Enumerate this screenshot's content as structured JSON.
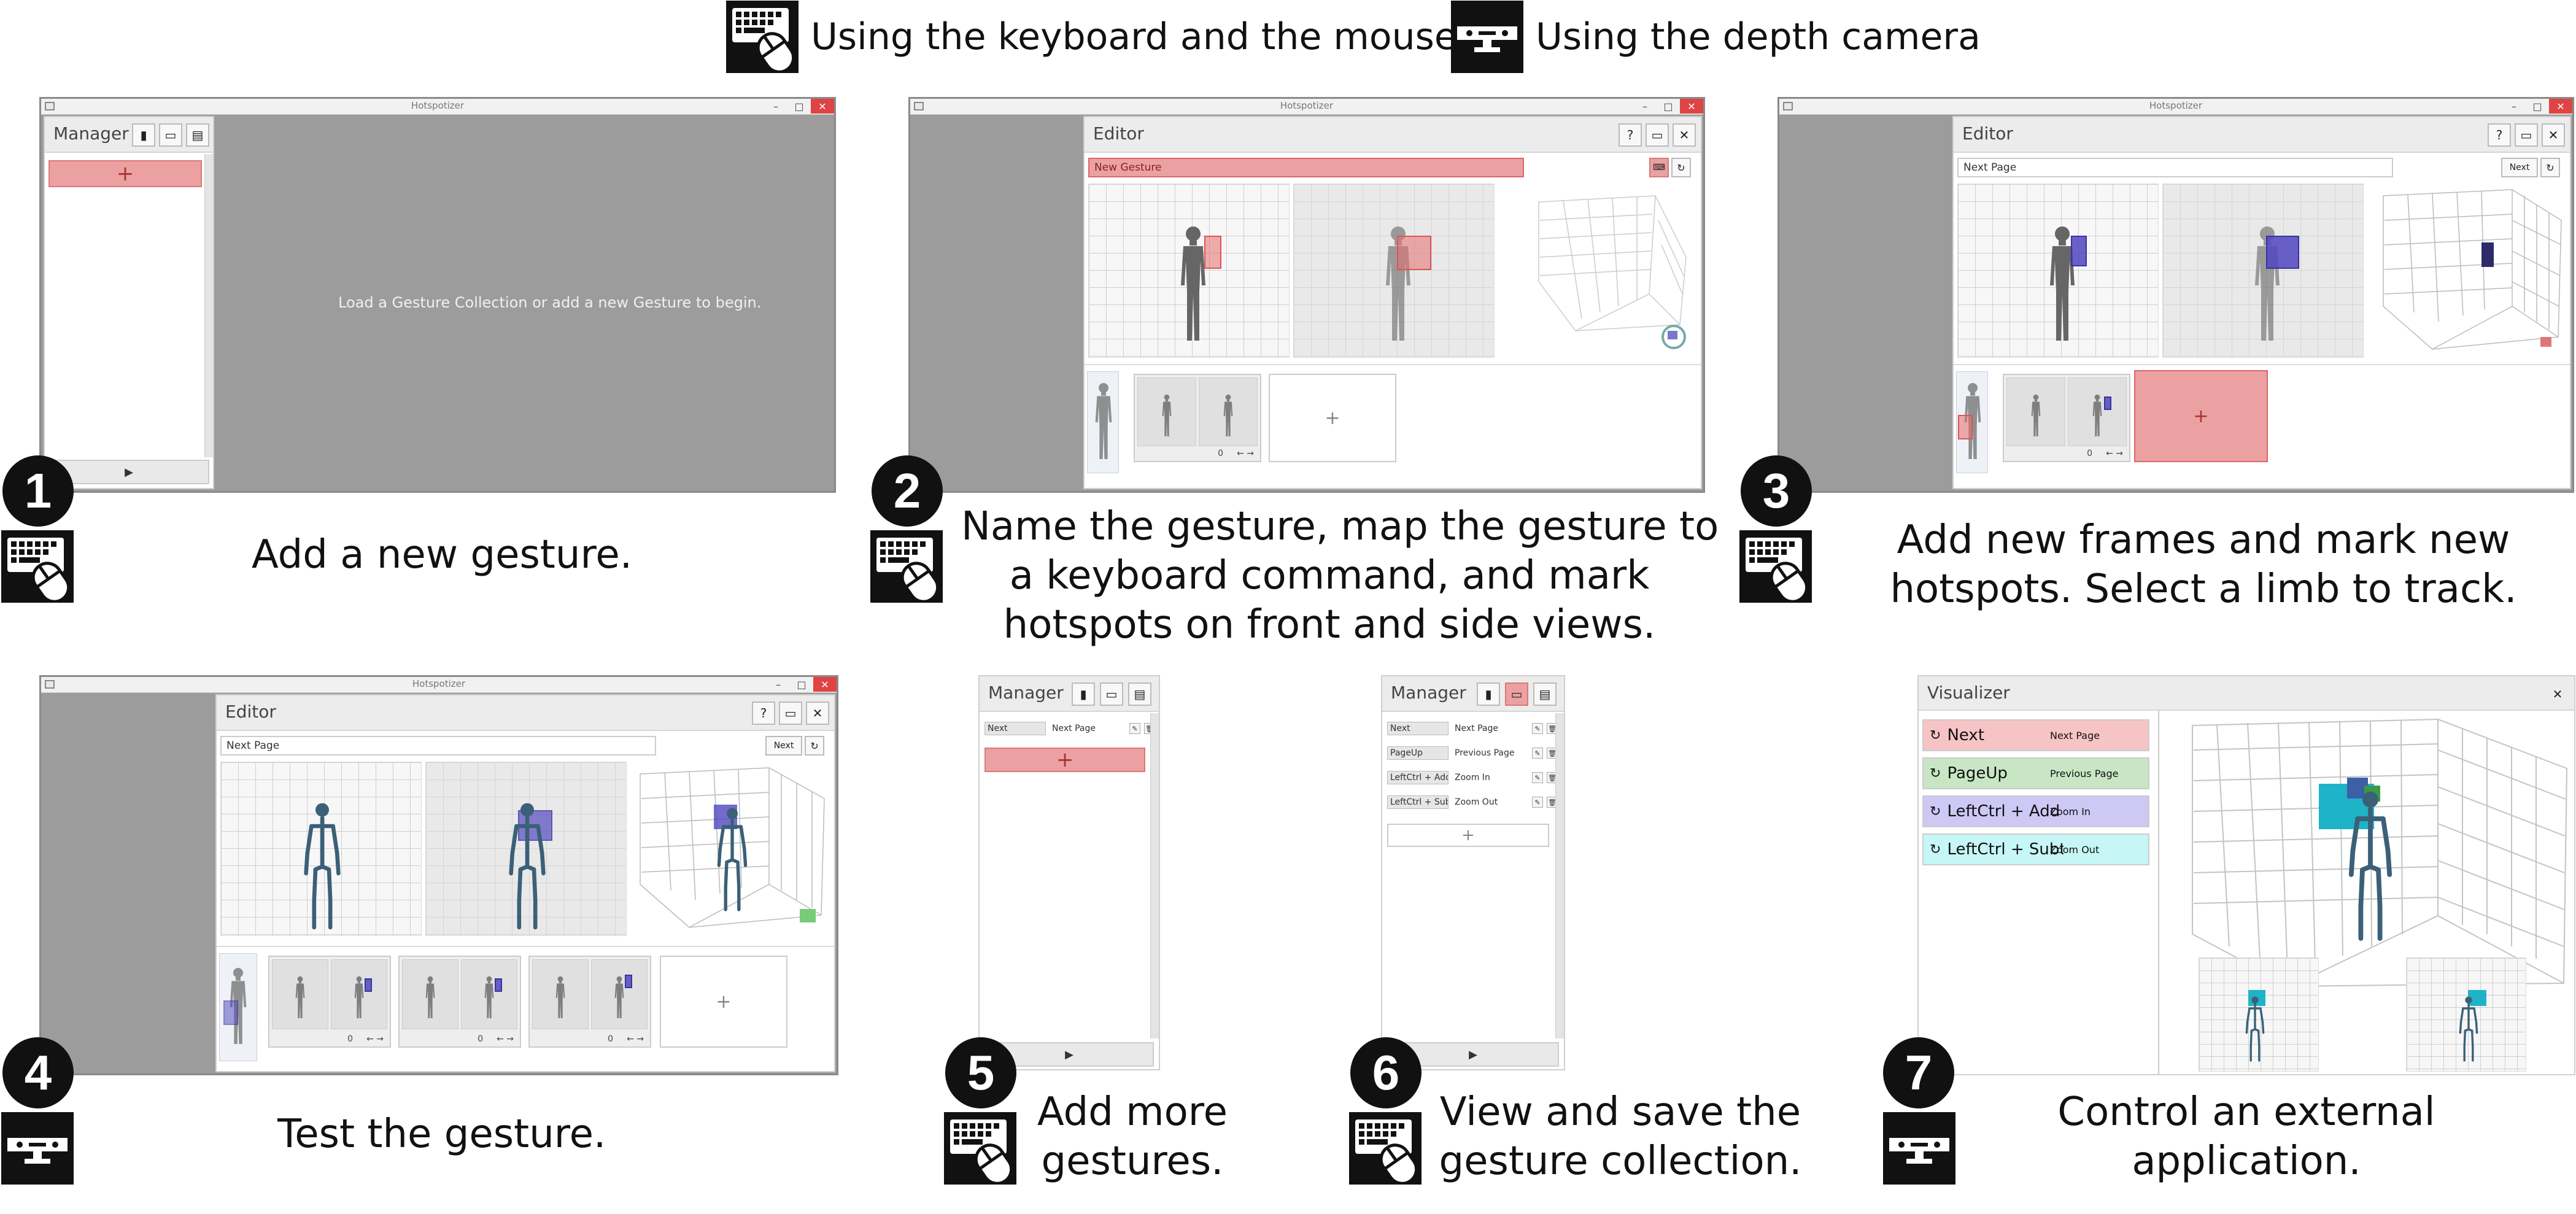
{
  "legend": {
    "keyboard_mouse": "Using the keyboard and the mouse",
    "depth_camera": "Using the depth camera"
  },
  "app_title": "Hotspotizer",
  "manager_title": "Manager",
  "editor_title": "Editor",
  "visualizer_title": "Visualizer",
  "empty_message": "Load a Gesture Collection or add a new Gesture to begin.",
  "add_symbol": "+",
  "play_symbol": "▶",
  "frame_counter": "0",
  "frame_nav": "← →",
  "panels": {
    "p2_gesture_name": "New Gesture",
    "p3_gesture_name": "Next Page",
    "p3_key_label": "Next",
    "p4_gesture_name": "Next Page",
    "p4_key_label": "Next",
    "p5_rows": [
      {
        "key": "Next",
        "name": "Next Page"
      }
    ],
    "p6_rows": [
      {
        "key": "Next",
        "name": "Next Page"
      },
      {
        "key": "PageUp",
        "name": "Previous Page"
      },
      {
        "key": "LeftCtrl + Add",
        "name": "Zoom In"
      },
      {
        "key": "LeftCtrl + Subtract",
        "name": "Zoom Out"
      }
    ],
    "p7_rows": [
      {
        "key": "Next",
        "name": "Next Page",
        "color": "#f6c4c4"
      },
      {
        "key": "PageUp",
        "name": "Previous Page",
        "color": "#c8e6c4"
      },
      {
        "key": "LeftCtrl + Add",
        "name": "Zoom In",
        "color": "#cdc8f4"
      },
      {
        "key": "LeftCtrl + Subtract",
        "name": "Zoom Out",
        "color": "#c6f6f6"
      }
    ]
  },
  "steps": [
    {
      "number": "1",
      "mode": "keyboard-mouse",
      "caption": [
        "Add a new gesture."
      ]
    },
    {
      "number": "2",
      "mode": "keyboard-mouse",
      "caption": [
        "Name the gesture, map the gesture to",
        "a keyboard command, and mark",
        "hotspots on front and side views."
      ]
    },
    {
      "number": "3",
      "mode": "keyboard-mouse",
      "caption": [
        "Add new frames and mark new",
        "hotspots. Select a limb to track."
      ]
    },
    {
      "number": "4",
      "mode": "depth-camera",
      "caption": [
        "Test the gesture."
      ]
    },
    {
      "number": "5",
      "mode": "keyboard-mouse",
      "caption": [
        "Add more",
        "gestures."
      ]
    },
    {
      "number": "6",
      "mode": "keyboard-mouse",
      "caption": [
        "View and save the",
        "gesture collection."
      ]
    },
    {
      "number": "7",
      "mode": "depth-camera",
      "caption": [
        "Control an external",
        "application."
      ]
    }
  ],
  "colors": {
    "hotspot_red": "#e66e6e",
    "hotspot_blue": "#5046be",
    "window_gray": "#9c9c9c",
    "close_red": "#e04343"
  },
  "icons": [
    "keyboard-mouse-icon",
    "depth-camera-icon",
    "close-icon",
    "add-icon",
    "play-icon",
    "refresh-icon",
    "save-icon",
    "new-icon",
    "help-icon"
  ]
}
